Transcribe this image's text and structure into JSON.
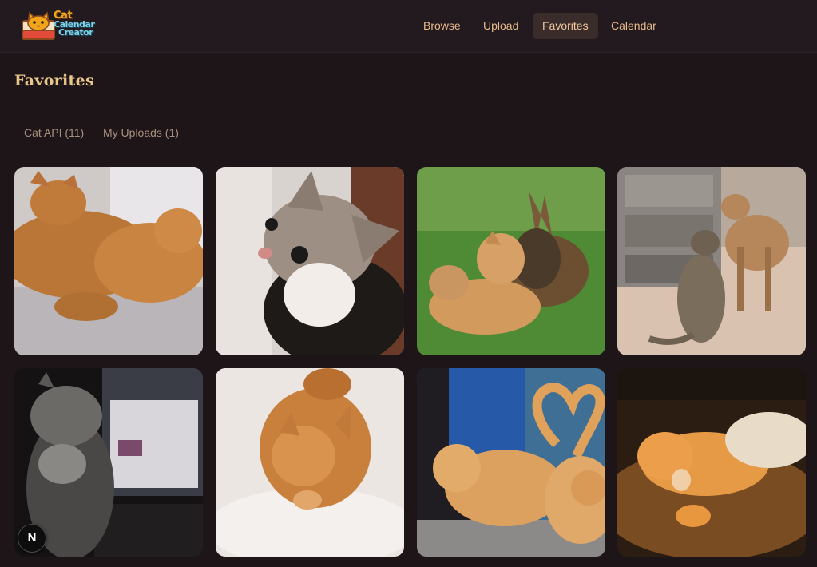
{
  "app": {
    "logo": {
      "line1": "Cat",
      "line2": "Calendar",
      "line3": "Creator"
    },
    "nav": [
      {
        "label": "Browse",
        "active": false
      },
      {
        "label": "Upload",
        "active": false
      },
      {
        "label": "Favorites",
        "active": true
      },
      {
        "label": "Calendar",
        "active": false
      }
    ]
  },
  "page": {
    "title": "Favorites",
    "tabs": [
      {
        "label": "Cat API (11)"
      },
      {
        "label": "My Uploads (1)"
      }
    ]
  },
  "gallery": {
    "photos": [
      {
        "subject": "two orange tabby cats cuddling on bed"
      },
      {
        "subject": "tabby kitten close-up"
      },
      {
        "subject": "orange cat and young deer nuzzling on grass"
      },
      {
        "subject": "spotted cat sniffing a fawn"
      },
      {
        "subject": "grey kitten looking up in front of laptop"
      },
      {
        "subject": "fluffy orange cat in snow"
      },
      {
        "subject": "two orange cats with tails forming a heart"
      },
      {
        "subject": "orange cat sleeping under a blanket"
      }
    ]
  },
  "floating_button": {
    "label": "N"
  },
  "colors": {
    "background": "#1e1519",
    "header": "#231a1f",
    "nav_text": "#e8b98a",
    "title": "#e9c68a",
    "tab_text": "#a88f7c"
  }
}
